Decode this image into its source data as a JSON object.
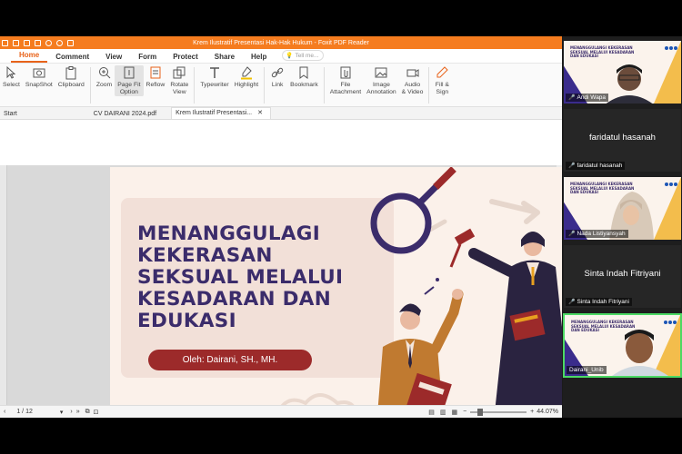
{
  "window": {
    "title": "Krem Ilustratif Presentasi Hak-Hak Hukum - Foxit PDF Reader"
  },
  "menu": {
    "tabs": [
      "Home",
      "Comment",
      "View",
      "Form",
      "Protect",
      "Share",
      "Help"
    ],
    "active_tab": "Home",
    "tell_me": "Tell me..."
  },
  "ribbon": {
    "select": "Select",
    "snapshot": "SnapShot",
    "clipboard": "Clipboard",
    "zoom": "Zoom",
    "page_fit_1": "Page Fit",
    "page_fit_2": "Option",
    "reflow": "Reflow",
    "rotate_1": "Rotate",
    "rotate_2": "View",
    "typewriter": "Typewriter",
    "highlight": "Highlight",
    "link": "Link",
    "bookmark": "Bookmark",
    "file_att_1": "File",
    "file_att_2": "Attachment",
    "image_ann_1": "Image",
    "image_ann_2": "Annotation",
    "audio_1": "Audio",
    "audio_2": "& Video",
    "fill_1": "Fill &",
    "fill_2": "Sign"
  },
  "doc_tabs": {
    "start": "Start",
    "tab1": "CV DAIRANI 2024.pdf",
    "tab2": "Krem Ilustratif Presentasi..."
  },
  "slide": {
    "title_lines": [
      "MENANGGULAGI",
      "KEKERASAN",
      "SEKSUAL MELALUI",
      "KESADARAN DAN",
      "EDUKASI"
    ],
    "author": "Oleh: Dairani, SH., MH."
  },
  "status": {
    "page": "1 / 12",
    "zoom": "44.07%"
  },
  "participants": [
    {
      "name": "Andi Wapa",
      "type": "video"
    },
    {
      "name": "faridatul hasanah",
      "type": "text",
      "center": "faridatul hasanah"
    },
    {
      "name": "Nada Listiyansyah",
      "type": "video"
    },
    {
      "name": "Sinta Indah Fitriyani",
      "type": "text",
      "center": "Sinta Indah Fitriyani"
    },
    {
      "name": "Dairani_Unib",
      "type": "video"
    }
  ],
  "tile_bg_text": "MENANGGULANGI KEKERASAN SEKSUAL MELALUI KESADARAN DAN EDUKASI",
  "colors": {
    "accent": "#f57c1f",
    "slide_title": "#3b2c6b",
    "author_pill": "#9c2a2a",
    "active_speaker": "#4cd964"
  }
}
